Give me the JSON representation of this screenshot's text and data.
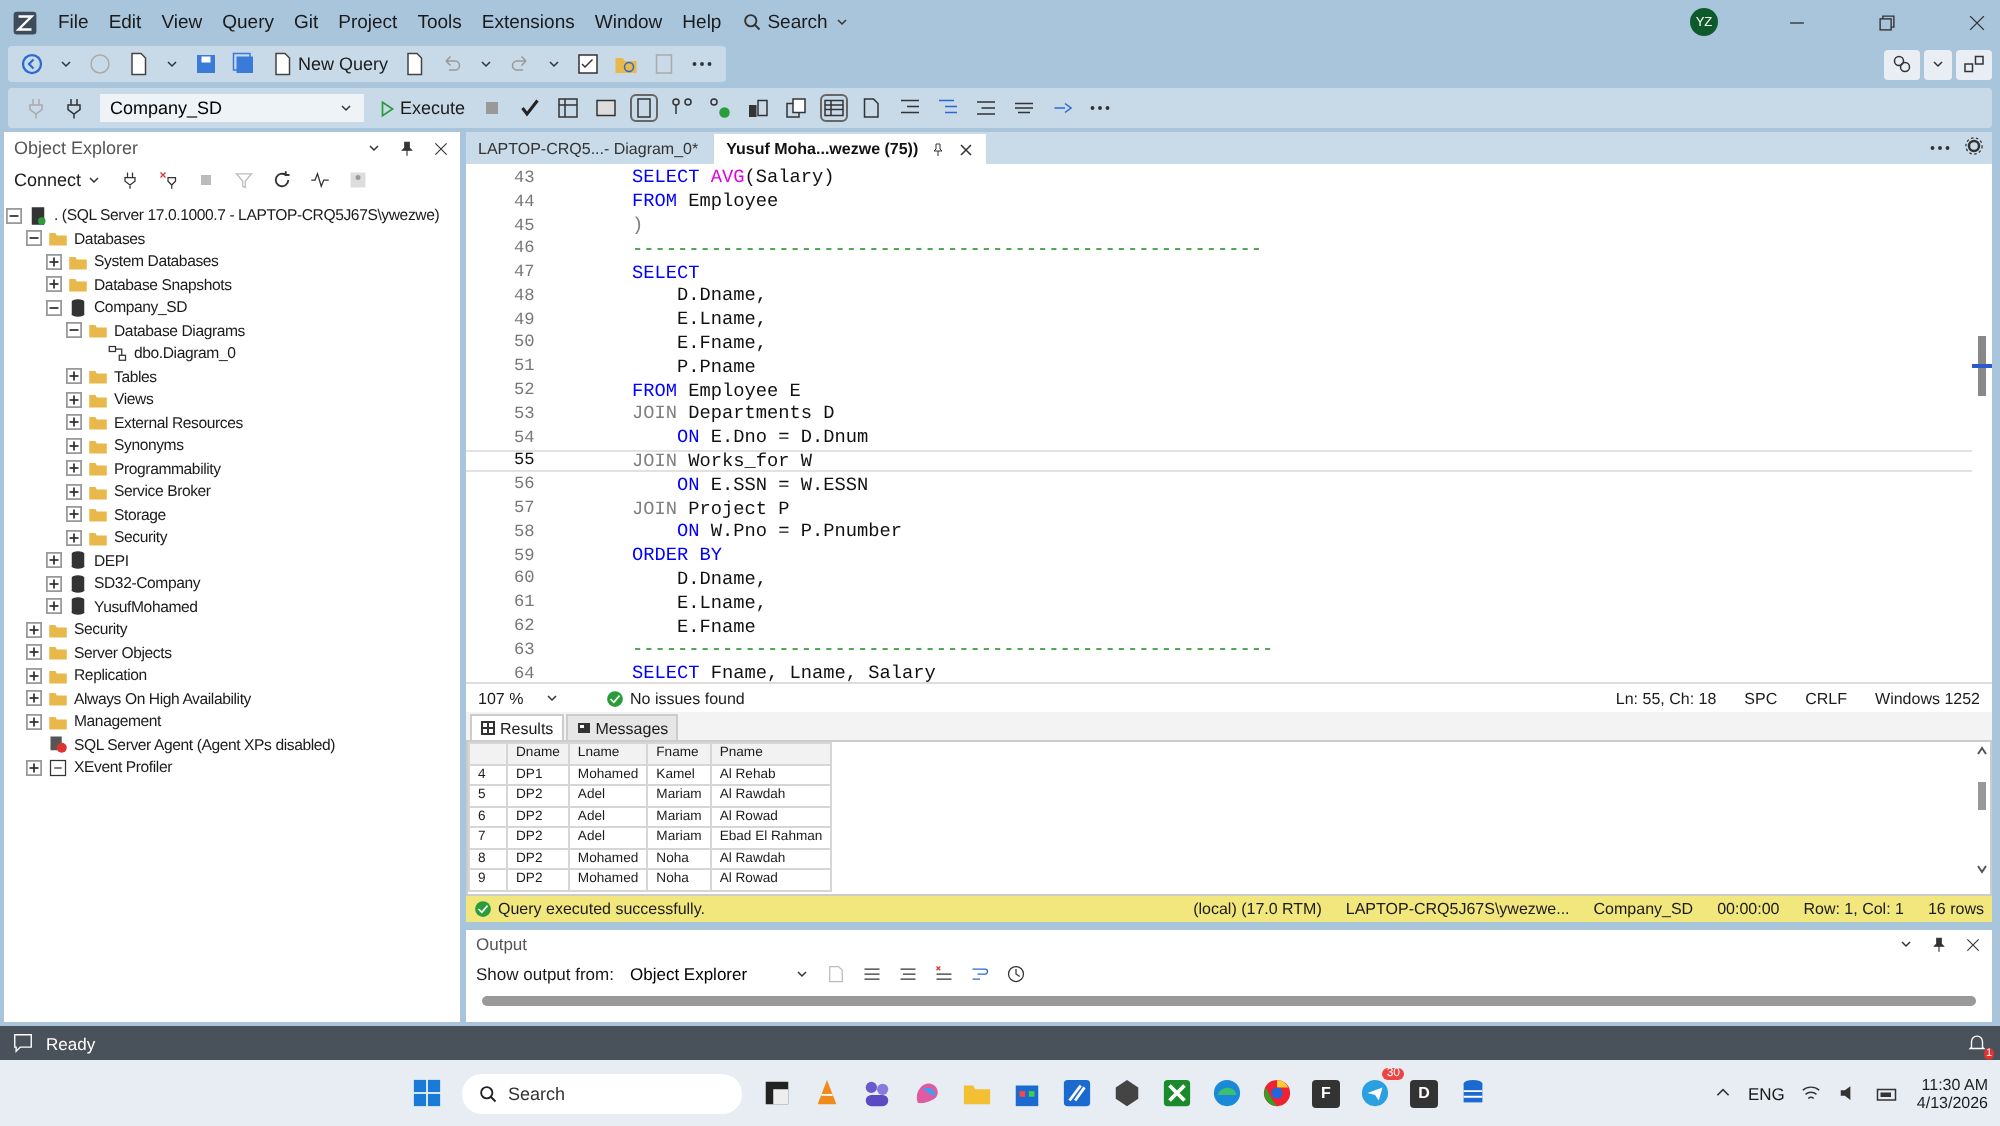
{
  "menu": [
    "File",
    "Edit",
    "View",
    "Query",
    "Git",
    "Project",
    "Tools",
    "Extensions",
    "Window",
    "Help"
  ],
  "menu_search": "Search",
  "avatar": "YZ",
  "toolbar": {
    "new_query": "New Query",
    "database": "Company_SD",
    "execute": "Execute"
  },
  "object_explorer": {
    "title": "Object Explorer",
    "connect": "Connect",
    "tree": [
      {
        "label": ". (SQL Server 17.0.1000.7 - LAPTOP-CRQ5J67S\\ywezwe)",
        "kind": "server",
        "expanded": true,
        "children": [
          {
            "label": "Databases",
            "kind": "folder",
            "expanded": true,
            "children": [
              {
                "label": "System Databases",
                "kind": "folder",
                "expanded": false
              },
              {
                "label": "Database Snapshots",
                "kind": "folder",
                "expanded": false
              },
              {
                "label": "Company_SD",
                "kind": "database",
                "expanded": true,
                "children": [
                  {
                    "label": "Database Diagrams",
                    "kind": "folder",
                    "expanded": true,
                    "children": [
                      {
                        "label": "dbo.Diagram_0",
                        "kind": "diagram"
                      }
                    ]
                  },
                  {
                    "label": "Tables",
                    "kind": "folder",
                    "expanded": false
                  },
                  {
                    "label": "Views",
                    "kind": "folder",
                    "expanded": false
                  },
                  {
                    "label": "External Resources",
                    "kind": "folder",
                    "expanded": false
                  },
                  {
                    "label": "Synonyms",
                    "kind": "folder",
                    "expanded": false
                  },
                  {
                    "label": "Programmability",
                    "kind": "folder",
                    "expanded": false
                  },
                  {
                    "label": "Service Broker",
                    "kind": "folder",
                    "expanded": false
                  },
                  {
                    "label": "Storage",
                    "kind": "folder",
                    "expanded": false
                  },
                  {
                    "label": "Security",
                    "kind": "folder",
                    "expanded": false
                  }
                ]
              },
              {
                "label": "DEPI",
                "kind": "database",
                "expanded": false
              },
              {
                "label": "SD32-Company",
                "kind": "database",
                "expanded": false
              },
              {
                "label": "YusufMohamed",
                "kind": "database",
                "expanded": false
              }
            ]
          },
          {
            "label": "Security",
            "kind": "folder",
            "expanded": false
          },
          {
            "label": "Server Objects",
            "kind": "folder",
            "expanded": false
          },
          {
            "label": "Replication",
            "kind": "folder",
            "expanded": false
          },
          {
            "label": "Always On High Availability",
            "kind": "folder",
            "expanded": false
          },
          {
            "label": "Management",
            "kind": "folder",
            "expanded": false
          },
          {
            "label": "SQL Server Agent (Agent XPs disabled)",
            "kind": "agent"
          },
          {
            "label": "XEvent Profiler",
            "kind": "profiler",
            "expanded": false
          }
        ]
      }
    ]
  },
  "editor_tabs": [
    {
      "label": "LAPTOP-CRQ5...- Diagram_0*",
      "selected": false
    },
    {
      "label": "Yusuf Moha...wezwe (75))",
      "selected": true
    }
  ],
  "code": [
    {
      "number": "43",
      "current": false,
      "tokens": [
        {
          "kind": "kw",
          "text": "SELECT "
        },
        {
          "kind": "fn",
          "text": "AVG"
        },
        {
          "kind": "plain",
          "text": "(Salary)"
        }
      ]
    },
    {
      "number": "44",
      "current": false,
      "tokens": [
        {
          "kind": "kw",
          "text": "FROM "
        },
        {
          "kind": "plain",
          "text": "Employee"
        }
      ]
    },
    {
      "number": "45",
      "current": false,
      "tokens": [
        {
          "kind": "punct",
          "text": ")"
        }
      ]
    },
    {
      "number": "46",
      "current": false,
      "tokens": [
        {
          "kind": "comment",
          "text": "--------------------------------------------------------"
        }
      ]
    },
    {
      "number": "47",
      "current": false,
      "tokens": [
        {
          "kind": "kw",
          "text": "SELECT"
        }
      ]
    },
    {
      "number": "48",
      "current": false,
      "tokens": [
        {
          "kind": "plain",
          "text": "    D.Dname,"
        }
      ]
    },
    {
      "number": "49",
      "current": false,
      "tokens": [
        {
          "kind": "plain",
          "text": "    E.Lname,"
        }
      ]
    },
    {
      "number": "50",
      "current": false,
      "tokens": [
        {
          "kind": "plain",
          "text": "    E.Fname,"
        }
      ]
    },
    {
      "number": "51",
      "current": false,
      "tokens": [
        {
          "kind": "plain",
          "text": "    P.Pname"
        }
      ]
    },
    {
      "number": "52",
      "current": false,
      "tokens": [
        {
          "kind": "kw",
          "text": "FROM "
        },
        {
          "kind": "plain",
          "text": "Employee E"
        }
      ]
    },
    {
      "number": "53",
      "current": false,
      "tokens": [
        {
          "kind": "join",
          "text": "JOIN "
        },
        {
          "kind": "plain",
          "text": "Departments D"
        }
      ]
    },
    {
      "number": "54",
      "current": false,
      "tokens": [
        {
          "kind": "kw",
          "text": "    ON "
        },
        {
          "kind": "plain",
          "text": "E.Dno = D.Dnum"
        }
      ]
    },
    {
      "number": "55",
      "current": true,
      "tokens": [
        {
          "kind": "join",
          "text": "JOIN "
        },
        {
          "kind": "plain",
          "text": "Works_for W"
        }
      ]
    },
    {
      "number": "56",
      "current": false,
      "tokens": [
        {
          "kind": "kw",
          "text": "    ON "
        },
        {
          "kind": "plain",
          "text": "E.SSN = W.ESSN"
        }
      ]
    },
    {
      "number": "57",
      "current": false,
      "tokens": [
        {
          "kind": "join",
          "text": "JOIN "
        },
        {
          "kind": "plain",
          "text": "Project P"
        }
      ]
    },
    {
      "number": "58",
      "current": false,
      "tokens": [
        {
          "kind": "kw",
          "text": "    ON "
        },
        {
          "kind": "plain",
          "text": "W.Pno = P.Pnumber"
        }
      ]
    },
    {
      "number": "59",
      "current": false,
      "tokens": [
        {
          "kind": "kw",
          "text": "ORDER BY"
        }
      ]
    },
    {
      "number": "60",
      "current": false,
      "tokens": [
        {
          "kind": "plain",
          "text": "    D.Dname,"
        }
      ]
    },
    {
      "number": "61",
      "current": false,
      "tokens": [
        {
          "kind": "plain",
          "text": "    E.Lname,"
        }
      ]
    },
    {
      "number": "62",
      "current": false,
      "tokens": [
        {
          "kind": "plain",
          "text": "    E.Fname"
        }
      ]
    },
    {
      "number": "63",
      "current": false,
      "tokens": [
        {
          "kind": "comment",
          "text": "---------------------------------------------------------"
        }
      ]
    },
    {
      "number": "64",
      "current": false,
      "tokens": [
        {
          "kind": "kw",
          "text": "SELECT "
        },
        {
          "kind": "plain",
          "text": "Fname, Lname, Salary"
        }
      ]
    }
  ],
  "editor_status": {
    "zoom": "107 %",
    "issues": "No issues found",
    "items": [
      "Ln: 55, Ch: 18",
      "SPC",
      "CRLF",
      "Windows 1252"
    ]
  },
  "result_tabs": [
    {
      "label": "Results",
      "selected": true
    },
    {
      "label": "Messages",
      "selected": false
    }
  ],
  "results": {
    "columns": [
      "Dname",
      "Lname",
      "Fname",
      "Pname"
    ],
    "rows": [
      {
        "number": "4",
        "cells": [
          "DP1",
          "Mohamed",
          "Kamel",
          "Al Rehab"
        ]
      },
      {
        "number": "5",
        "cells": [
          "DP2",
          "Adel",
          "Mariam",
          "Al Rawdah"
        ]
      },
      {
        "number": "6",
        "cells": [
          "DP2",
          "Adel",
          "Mariam",
          "Al Rowad"
        ]
      },
      {
        "number": "7",
        "cells": [
          "DP2",
          "Adel",
          "Mariam",
          "Ebad El Rahman"
        ]
      },
      {
        "number": "8",
        "cells": [
          "DP2",
          "Mohamed",
          "Noha",
          "Al Rawdah"
        ]
      },
      {
        "number": "9",
        "cells": [
          "DP2",
          "Mohamed",
          "Noha",
          "Al Rowad"
        ]
      }
    ]
  },
  "query_status": {
    "message": "Query executed successfully.",
    "items": [
      "(local) (17.0 RTM)",
      "LAPTOP-CRQ5J67S\\ywezwe...",
      "Company_SD",
      "00:00:00",
      "Row: 1, Col: 1",
      "16 rows"
    ]
  },
  "output": {
    "title": "Output",
    "label": "Show output from:",
    "source": "Object Explorer"
  },
  "status_bar": {
    "text": "Ready",
    "notifications": "1"
  },
  "taskbar": {
    "search": "Search",
    "app_tiles": [
      "F",
      "D"
    ],
    "badge": "30",
    "language": "ENG",
    "time": "11:30 AM",
    "date": "4/13/2026"
  }
}
